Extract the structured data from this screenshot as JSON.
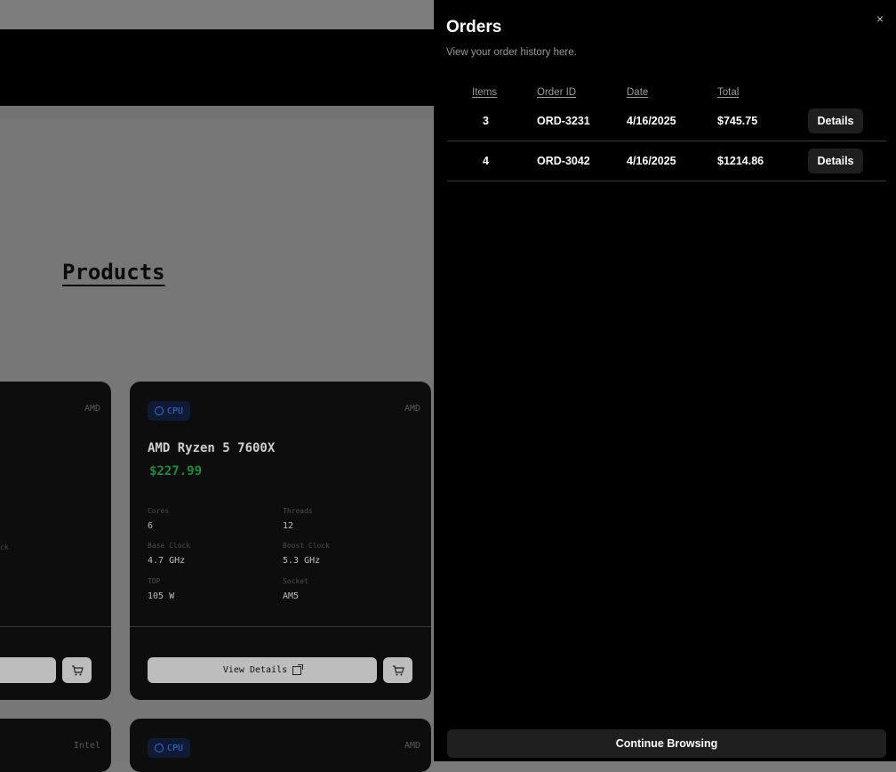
{
  "page": {
    "products_title": "Products"
  },
  "cards": [
    {
      "brand": "AMD",
      "spec_fragment": "ck"
    },
    {
      "badge": "CPU",
      "brand": "AMD",
      "name": "AMD Ryzen 5 7600X",
      "price": "$227.99",
      "specs": {
        "cores_label": "Cores",
        "cores": "6",
        "threads_label": "Threads",
        "threads": "12",
        "base_label": "Base Clock",
        "base": "4.7 GHz",
        "boost_label": "Boost Clock",
        "boost": "5.3 GHz",
        "tdp_label": "TDP",
        "tdp": "105 W",
        "socket_label": "Socket",
        "socket": "AM5"
      },
      "view_details": "View Details"
    },
    {
      "brand": "Intel"
    },
    {
      "badge": "CPU",
      "brand": "AMD"
    }
  ],
  "drawer": {
    "title": "Orders",
    "subtitle": "View your order history here.",
    "close": "×",
    "columns": [
      "Items",
      "Order ID",
      "Date",
      "Total"
    ],
    "orders": [
      {
        "items": "3",
        "id": "ORD-3231",
        "date": "4/16/2025",
        "total": "$745.75",
        "action": "Details"
      },
      {
        "items": "4",
        "id": "ORD-3042",
        "date": "4/16/2025",
        "total": "$1214.86",
        "action": "Details"
      }
    ],
    "continue": "Continue Browsing"
  },
  "icons": {
    "cpu": "cpu-icon",
    "cart": "cart-icon",
    "external": "external-link-icon",
    "close": "close-icon"
  }
}
